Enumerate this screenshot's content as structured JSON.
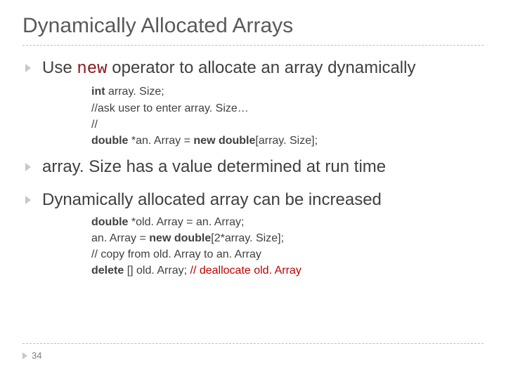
{
  "title": "Dynamically Allocated Arrays",
  "bullets": {
    "b1_pre": "Use ",
    "b1_kw": "new",
    "b1_post": " operator to allocate an array dynamically",
    "b2": "array. Size has a value determined at run time",
    "b3": "Dynamically allocated array can be increased"
  },
  "code1": {
    "l1a": "int",
    "l1b": " array. Size;",
    "l2": "//ask user to enter array. Size…",
    "l3": "//",
    "l4a": "double ",
    "l4b": "*an. Array = ",
    "l4c": "new double",
    "l4d": "[array. Size];"
  },
  "code2": {
    "l1a": "double ",
    "l1b": "*old. Array = an. Array;",
    "l2a": " an. Array = ",
    "l2b": "new double",
    "l2c": "[2*array. Size];",
    "l3": "// copy from old. Array to an. Array",
    "l4a": "delete ",
    "l4b": "[] old. Array; ",
    "l4c": "// deallocate old. Array"
  },
  "page_number": "34"
}
